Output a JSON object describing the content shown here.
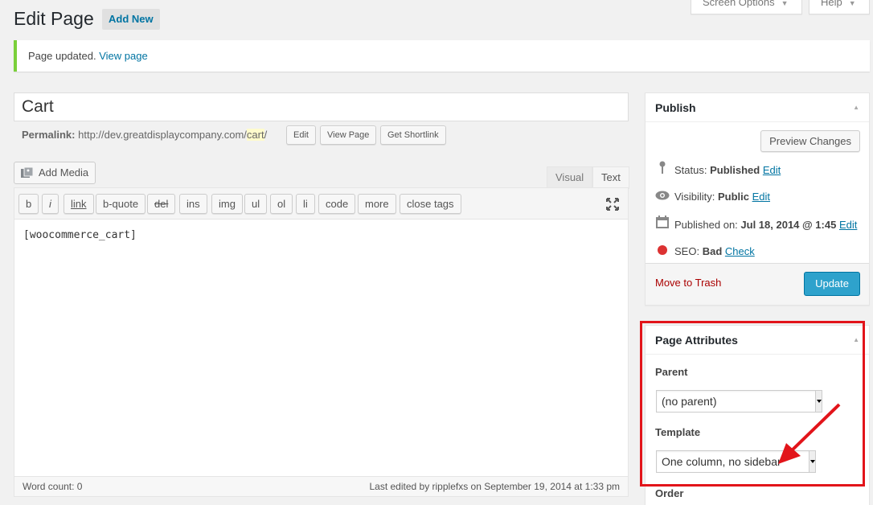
{
  "screen_options": {
    "screen_label": "Screen Options",
    "help_label": "Help"
  },
  "header": {
    "title": "Edit Page",
    "add_new": "Add New"
  },
  "notice": {
    "text": "Page updated.",
    "link": "View page"
  },
  "post": {
    "title": "Cart",
    "permalink_label": "Permalink:",
    "permalink_base": "http://dev.greatdisplaycompany.com/",
    "permalink_slug": "cart",
    "permalink_end": "/",
    "edit_btn": "Edit",
    "view_btn": "View Page",
    "shortlink_btn": "Get Shortlink"
  },
  "editor": {
    "add_media": "Add Media",
    "tab_visual": "Visual",
    "tab_text": "Text",
    "quicktags": [
      "b",
      "i",
      "link",
      "b-quote",
      "del",
      "ins",
      "img",
      "ul",
      "ol",
      "li",
      "code",
      "more",
      "close tags"
    ],
    "content": "[woocommerce_cart]",
    "word_count": "Word count: 0",
    "last_edited": "Last edited by ripplefxs on September 19, 2014 at 1:33 pm"
  },
  "publish": {
    "title": "Publish",
    "preview_btn": "Preview Changes",
    "status_label": "Status:",
    "status_value": "Published",
    "visibility_label": "Visibility:",
    "visibility_value": "Public",
    "published_label": "Published on:",
    "published_value": "Jul 18, 2014 @ 1:45",
    "seo_label": "SEO:",
    "seo_value": "Bad",
    "seo_link": "Check",
    "edit_link": "Edit",
    "trash": "Move to Trash",
    "update_btn": "Update"
  },
  "attributes": {
    "title": "Page Attributes",
    "parent_label": "Parent",
    "parent_value": "(no parent)",
    "template_label": "Template",
    "template_value": "One column, no sidebar",
    "order_label": "Order"
  },
  "colors": {
    "annotation": "#e2141a",
    "accent": "#2ea2cc",
    "link": "#0074a2",
    "notice": "#7ad03a"
  }
}
